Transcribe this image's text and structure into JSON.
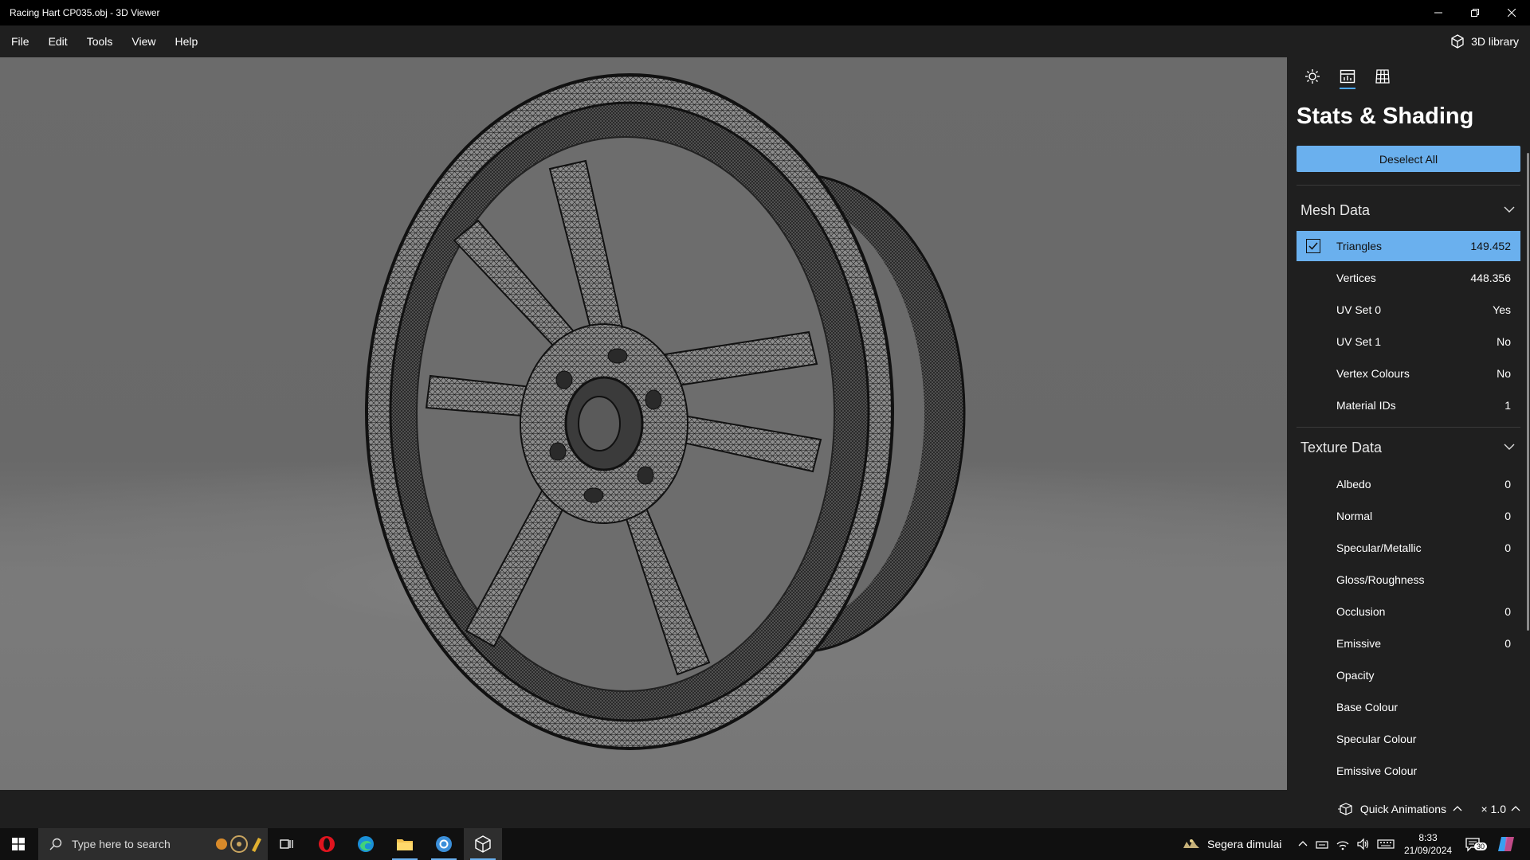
{
  "window": {
    "title": "Racing Hart CP035.obj - 3D Viewer",
    "controls": [
      "minimize-icon",
      "restore-icon",
      "close-icon"
    ]
  },
  "menu": {
    "items": [
      "File",
      "Edit",
      "Tools",
      "View",
      "Help"
    ],
    "library_label": "3D library"
  },
  "panel": {
    "tabs": [
      "lighting-icon",
      "stats-icon",
      "grid-icon"
    ],
    "active_tab": "stats-icon",
    "title": "Stats & Shading",
    "deselect_label": "Deselect All",
    "mesh_section": {
      "title": "Mesh Data",
      "rows": [
        {
          "label": "Triangles",
          "value": "149.452",
          "selected": true
        },
        {
          "label": "Vertices",
          "value": "448.356"
        },
        {
          "label": "UV Set 0",
          "value": "Yes"
        },
        {
          "label": "UV Set 1",
          "value": "No"
        },
        {
          "label": "Vertex Colours",
          "value": "No"
        },
        {
          "label": "Material IDs",
          "value": "1"
        }
      ]
    },
    "texture_section": {
      "title": "Texture Data",
      "rows": [
        {
          "label": "Albedo",
          "value": "0"
        },
        {
          "label": "Normal",
          "value": "0"
        },
        {
          "label": "Specular/Metallic",
          "value": "0"
        },
        {
          "label": "Gloss/Roughness",
          "value": ""
        },
        {
          "label": "Occlusion",
          "value": "0"
        },
        {
          "label": "Emissive",
          "value": "0"
        },
        {
          "label": "Opacity",
          "value": ""
        },
        {
          "label": "Base Colour",
          "value": ""
        },
        {
          "label": "Specular Colour",
          "value": ""
        },
        {
          "label": "Emissive Colour",
          "value": ""
        }
      ]
    }
  },
  "status": {
    "quick_animations_label": "Quick Animations",
    "speed_label": "× 1.0"
  },
  "taskbar": {
    "search_placeholder": "Type here to search",
    "weather_text": "Segera dimulai",
    "time": "8:33",
    "date": "21/09/2024",
    "notification_count": "30"
  },
  "colors": {
    "accent": "#6ab0ee",
    "panel_bg": "#1f1f1f",
    "viewport_bg": "#6b6b6b"
  }
}
